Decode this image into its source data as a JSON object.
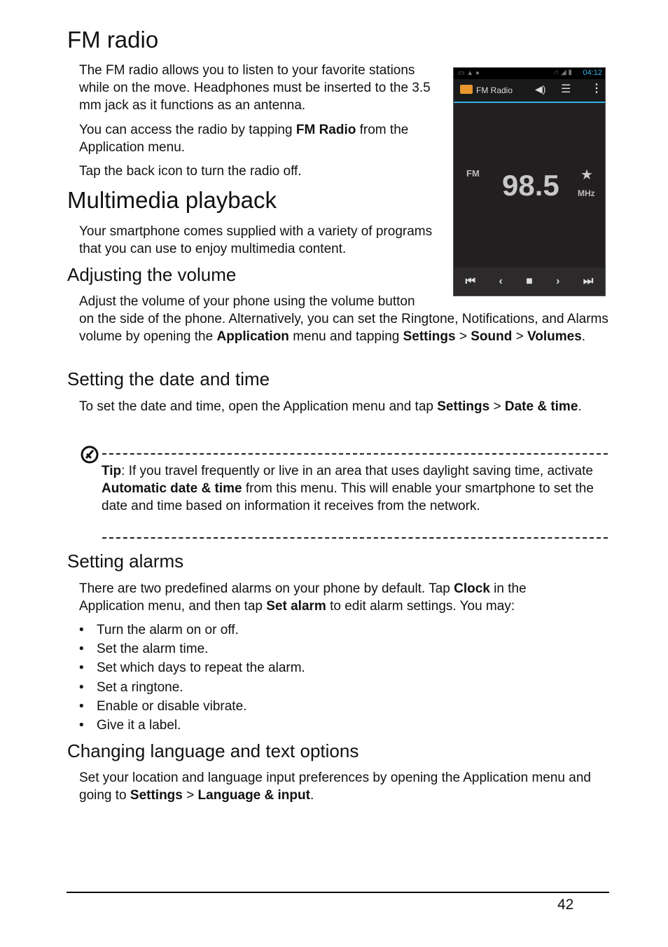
{
  "fm_radio": {
    "heading": "FM radio",
    "para1": "The FM radio allows you to listen to your favorite stations while on the move. Headphones must be inserted to the 3.5 mm jack as it functions as an antenna.",
    "para2_pre": "You can access the radio by tapping ",
    "para2_bold": "FM Radio",
    "para2_post": " from the Application menu.",
    "para3": "Tap the back icon to turn the radio off."
  },
  "phone": {
    "status_time": "04:12",
    "app_title": "FM Radio",
    "band": "FM",
    "frequency": "98.5",
    "unit": "MHz",
    "accent_color": "#33b5e5"
  },
  "multimedia": {
    "heading": "Multimedia playback",
    "para": "Your smartphone comes supplied with a variety of programs that you can use to enjoy multimedia content."
  },
  "volume": {
    "heading": "Adjusting the volume",
    "line1": "Adjust the volume of your phone using the volume button",
    "line2_pre": "on the side of the phone. Alternatively, you can set the Ringtone, Notifications, and Alarms volume by opening the ",
    "b1": "Application",
    "mid1": " menu and tapping ",
    "b2": "Settings",
    "gt1": " > ",
    "b3": "Sound",
    "gt2": " > ",
    "b4": "Volumes",
    "end": "."
  },
  "datetime": {
    "heading": "Setting the date and time",
    "pre": "To set the date and time, open the Application menu and tap ",
    "b1": "Settings",
    "gt": " > ",
    "b2": "Date & time",
    "end": "."
  },
  "tip": {
    "label": "Tip",
    "pre": ": If you travel frequently or live in an area that uses daylight saving time, activate ",
    "bold": "Automatic date & time",
    "post": " from this menu. This will enable your smartphone to set the date and time based on information it receives from the network."
  },
  "alarms": {
    "heading": "Setting alarms",
    "pre": "There are two predefined alarms on your phone by default. Tap ",
    "b1": "Clock",
    "mid": " in the Application menu, and then tap ",
    "b2": "Set alarm",
    "post": " to edit alarm settings. You may:",
    "bullet_glyph": "•",
    "bullets": [
      "Turn the alarm on or off.",
      "Set the alarm time.",
      "Set which days to repeat the alarm.",
      "Set a ringtone.",
      "Enable or disable vibrate.",
      "Give it a label."
    ]
  },
  "language": {
    "heading": "Changing language and text options",
    "pre": "Set your location and language input preferences by opening the Application menu and going to ",
    "b1": "Settings",
    "gt": " > ",
    "b2": "Language & input",
    "end": "."
  },
  "page_number": "42"
}
